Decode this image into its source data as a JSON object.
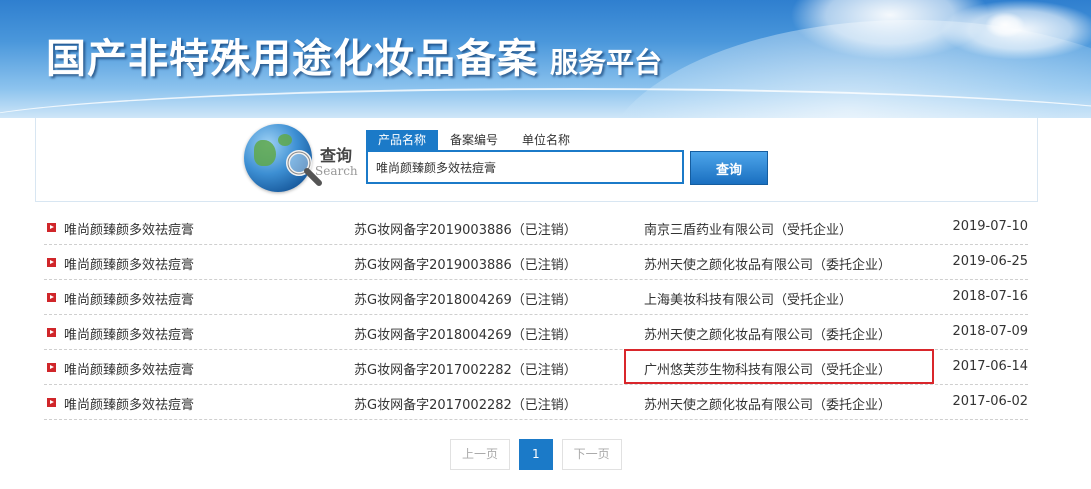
{
  "header": {
    "title_main": "国产非特殊用途化妆品备案",
    "title_sub": "服务平台"
  },
  "search": {
    "label_cn": "查询",
    "label_en": "Search",
    "tabs": [
      {
        "label": "产品名称",
        "active": true
      },
      {
        "label": "备案编号",
        "active": false
      },
      {
        "label": "单位名称",
        "active": false
      }
    ],
    "query": "唯尚颜臻颜多效祛痘膏",
    "button_label": "查询"
  },
  "results": [
    {
      "name": "唯尚颜臻颜多效祛痘膏",
      "reg": "苏G妆网备字2019003886（已注销）",
      "company": "南京三盾药业有限公司（受托企业）",
      "date": "2019-07-10"
    },
    {
      "name": "唯尚颜臻颜多效祛痘膏",
      "reg": "苏G妆网备字2019003886（已注销）",
      "company": "苏州天使之颜化妆品有限公司（委托企业）",
      "date": "2019-06-25"
    },
    {
      "name": "唯尚颜臻颜多效祛痘膏",
      "reg": "苏G妆网备字2018004269（已注销）",
      "company": "上海美妆科技有限公司（受托企业）",
      "date": "2018-07-16"
    },
    {
      "name": "唯尚颜臻颜多效祛痘膏",
      "reg": "苏G妆网备字2018004269（已注销）",
      "company": "苏州天使之颜化妆品有限公司（委托企业）",
      "date": "2018-07-09"
    },
    {
      "name": "唯尚颜臻颜多效祛痘膏",
      "reg": "苏G妆网备字2017002282（已注销）",
      "company": "广州悠芙莎生物科技有限公司（受托企业）",
      "date": "2017-06-14"
    },
    {
      "name": "唯尚颜臻颜多效祛痘膏",
      "reg": "苏G妆网备字2017002282（已注销）",
      "company": "苏州天使之颜化妆品有限公司（委托企业）",
      "date": "2017-06-02"
    }
  ],
  "pagination": {
    "prev_label": "上一页",
    "current_page": "1",
    "next_label": "下一页"
  },
  "colors": {
    "accent": "#1b7ac8",
    "highlight": "#d9262b",
    "bullet": "#d0262a"
  }
}
